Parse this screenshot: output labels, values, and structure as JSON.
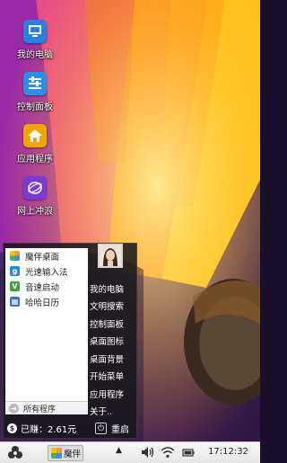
{
  "desktop": {
    "icons": [
      {
        "label": "我的电脑",
        "icon": "computer-icon"
      },
      {
        "label": "控制面板",
        "icon": "control-panel-icon"
      },
      {
        "label": "应用程序",
        "icon": "home-app-icon"
      },
      {
        "label": "网上冲浪",
        "icon": "browser-icon"
      }
    ]
  },
  "start_menu": {
    "programs": [
      {
        "label": "魔伴桌面",
        "icon": "mobang-desktop-icon"
      },
      {
        "label": "光速输入法",
        "icon": "input-method-icon"
      },
      {
        "label": "音速启动",
        "icon": "quick-launch-icon"
      },
      {
        "label": "哈哈日历",
        "icon": "calendar-icon"
      }
    ],
    "all_programs": "所有程序",
    "right_items": [
      "我的电脑",
      "文明搜索",
      "控制面板",
      "桌面图标",
      "桌面背景",
      "开始菜单",
      "应用程序",
      "关于.."
    ],
    "earned_prefix": "已赚：",
    "earned_value": "2.61元",
    "restart_label": "重启"
  },
  "taskbar": {
    "task_label": "魔伴",
    "clock": "17:12:32"
  },
  "colors": {
    "menu_bg": "#16161c",
    "taskbar_bg": "#eeeeee"
  }
}
